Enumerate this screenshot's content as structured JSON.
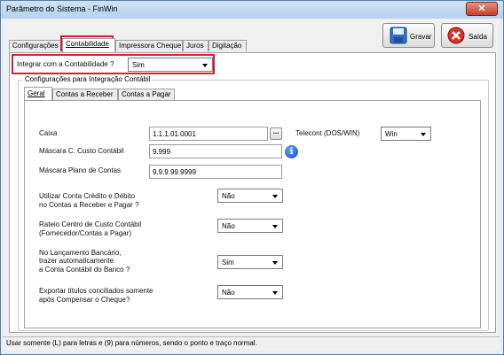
{
  "window": {
    "title": "Parâmetro do Sistema - FinWin",
    "close_glyph": "✕"
  },
  "toolbar": {
    "save_label": "Gravar",
    "exit_label": "Saída"
  },
  "tabs": [
    "Configurações",
    "Contabilidade",
    "Impressora Cheque",
    "Juros",
    "Digitação"
  ],
  "integrar": {
    "label": "Integrar com a Contabilidade ?",
    "value": "Sim"
  },
  "group_title": "Configurações para Integração Contábil",
  "subtabs": [
    "Geral",
    "Contas a Receber",
    "Contas a Pagar"
  ],
  "geral": {
    "caixa": {
      "label": "Caixa",
      "value": "1.1.1.01.0001",
      "lookup_glyph": "..."
    },
    "telecont": {
      "label": "Telecont (DOS/WIN)",
      "value": "Win"
    },
    "mascara_custo": {
      "label": "Máscara C. Custo Contábil",
      "value": "9.999",
      "info_glyph": "i"
    },
    "mascara_plano": {
      "label": "Máscara Plano de Contas",
      "value": "9.9.9.99.9999"
    },
    "utilizar_conta": {
      "label_l1": "Utilizar Conta Crédito e Débito",
      "label_l2": "no Contas a Receber e Pagar ?",
      "value": "Não"
    },
    "rateio": {
      "label_l1": "Rateio Centro de Custo Contábil",
      "label_l2": "(Fornecedor/Contas a Pagar)",
      "value": "Não"
    },
    "lancamento": {
      "label_l1": "No Lançamento Bancário,",
      "label_l2": "trazer automaticamente",
      "label_l3": "a Conta Contábil do Banco ?",
      "value": "Sim"
    },
    "exportar": {
      "label_l1": "Exportar títulos conciliados somente",
      "label_l2": "após Compensar o Cheque?",
      "value": "Não"
    }
  },
  "status": "Usar somente (L) para letras e (9) para números, sendo o ponto e traço normal.",
  "colors": {
    "highlight": "#d61f2a",
    "info_blue": "#0c47b8"
  }
}
